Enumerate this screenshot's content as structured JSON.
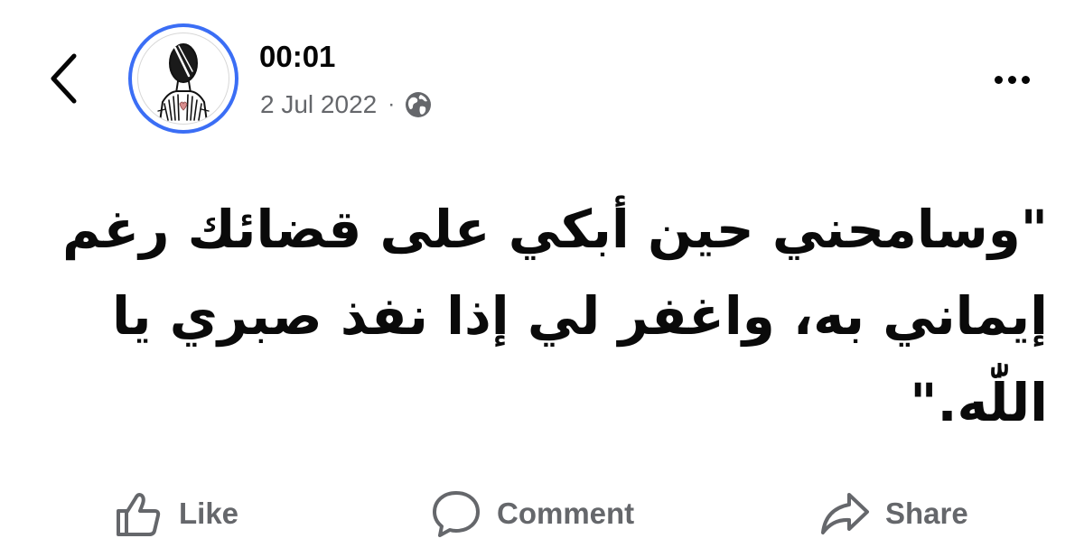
{
  "post": {
    "author_name": "00:01",
    "date": "2 Jul 2022",
    "separator": "·",
    "audience_icon": "globe-icon",
    "text_lines": [
      "\"وسامحني حين أبكي على قضائك رغم",
      "إيماني به، واغفر لي إذا نفذ صبري يا",
      "اللّٰه.\""
    ]
  },
  "header": {
    "back_icon": "chevron-left-icon",
    "more_icon": "more-horizontal-icon"
  },
  "actions": {
    "like_label": "Like",
    "comment_label": "Comment",
    "share_label": "Share"
  },
  "colors": {
    "avatar_ring": "#3b6ef5",
    "secondary_text": "#65676b",
    "primary_text": "#050505"
  }
}
